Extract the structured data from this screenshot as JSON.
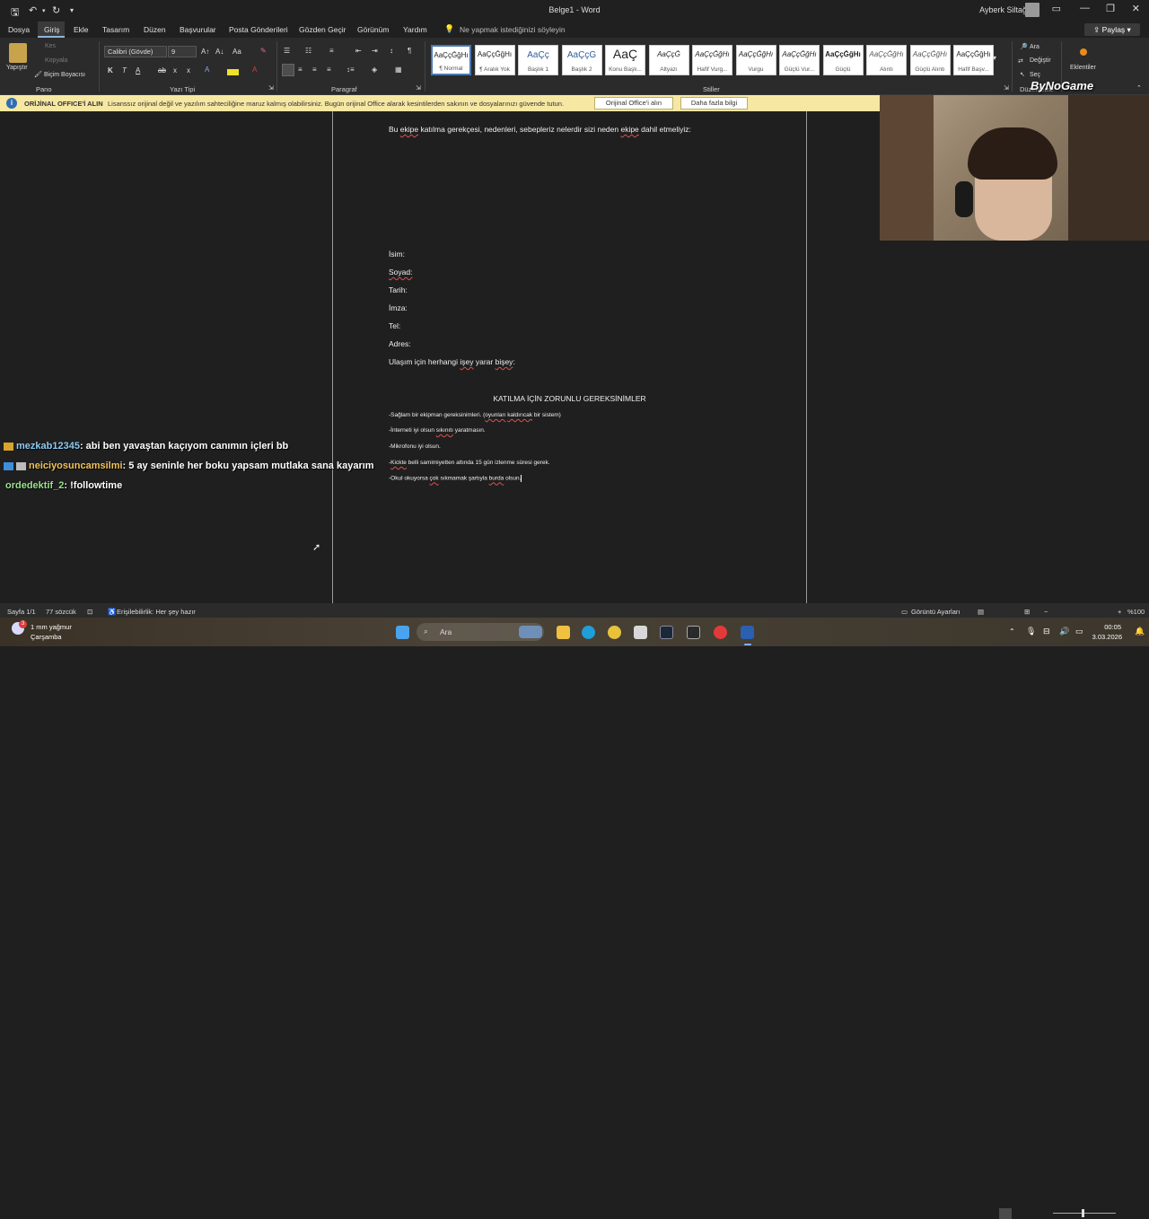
{
  "window": {
    "title": "Belge1  -  Word",
    "user": "Ayberk Siltağ",
    "share_label": "Paylaş"
  },
  "menu": {
    "items": [
      "Dosya",
      "Giriş",
      "Ekle",
      "Tasarım",
      "Düzen",
      "Başvurular",
      "Posta Gönderileri",
      "Gözden Geçir",
      "Görünüm",
      "Yardım"
    ],
    "active": "Giriş",
    "tell_me": "Ne yapmak istediğinizi söyleyin"
  },
  "ribbon": {
    "clipboard": {
      "paste": "Yapıştır",
      "cut": "Kes",
      "copy": "Kopyala",
      "format_painter": "Biçim Boyacısı",
      "label": "Pano"
    },
    "font": {
      "name": "Calibri (Gövde)",
      "size": "9",
      "label": "Yazı Tipi",
      "bold": "K",
      "italic": "T",
      "underline": "A",
      "strike": "ab",
      "sub": "x",
      "sup": "x",
      "case": "Aa"
    },
    "paragraph": {
      "label": "Paragraf"
    },
    "styles": {
      "label": "Stiller",
      "items": [
        {
          "sample": "AaÇçĞğHı",
          "name": "¶ Normal"
        },
        {
          "sample": "AaÇçĞğHı",
          "name": "¶ Aralık Yok"
        },
        {
          "sample": "AaÇç",
          "name": "Başlık 1"
        },
        {
          "sample": "AaÇçĞ",
          "name": "Başlık 2"
        },
        {
          "sample": "AaÇ",
          "name": "Konu Başlı..."
        },
        {
          "sample": "AaÇçĞ",
          "name": "Altyazı"
        },
        {
          "sample": "AaÇçĞğHı",
          "name": "Hafif Vurg..."
        },
        {
          "sample": "AaÇçĞğHı",
          "name": "Vurgu"
        },
        {
          "sample": "AaÇçĞğHı",
          "name": "Güçlü Vur..."
        },
        {
          "sample": "AaÇçĞğHı",
          "name": "Güçlü"
        },
        {
          "sample": "AaÇçĞğHı",
          "name": "Alıntı"
        },
        {
          "sample": "AaÇçĞğHı",
          "name": "Güçlü Alıntı"
        },
        {
          "sample": "AaÇçĞğHı",
          "name": "Hafif Başv..."
        }
      ]
    },
    "editing": {
      "find": "Ara",
      "replace": "Değiştir",
      "select": "Seç",
      "label": "Düzenleme"
    },
    "addins": {
      "label": "Eklentiler"
    }
  },
  "warning": {
    "title": "ORİJİNAL OFFICE'İ ALIN",
    "text": "Lisanssız orijinal değil ve yazılım sahteciliğine maruz kalmış olabilirsiniz. Bugün orijinal Office alarak kesintilerden sakının ve dosyalarınızı güvende tutun.",
    "buy_button": "Orijinal Office'i alın",
    "more_button": "Daha fazla bilgi"
  },
  "document": {
    "question": {
      "pre": "Bu ",
      "w1": "ekipe",
      "mid": " katılma gerekçesi, nedenleri, sebepleriz nelerdir sizi neden ",
      "w2": "ekipe",
      "post": " dahil etmeliyiz:"
    },
    "fields": {
      "isim": "İsim:",
      "soyad": "Soyad:",
      "tarih": "Tarih:",
      "imza": "İmza:",
      "tel": "Tel:",
      "adres": "Adres:",
      "contact_pre": "Ulaşım için herhangi ",
      "contact_w1": "işey",
      "contact_mid": " yarar ",
      "contact_w2": "bişey",
      "contact_post": ":"
    },
    "req_heading": "KATILMA İÇİN ZORUNLU GEREKSİNİMLER",
    "req1": {
      "pre": "-Sağlam bir ekipman gereksinimleri. (",
      "w1": "oyunları",
      "mid": " ",
      "w2": "kaldırıcak",
      "post": " bir sistem)"
    },
    "req2": {
      "pre": "-İnterneti iyi olsun ",
      "w1": "sıkınıtı",
      "post": " yaratmasın."
    },
    "req3": {
      "text": "-Mikrofonu iyi olsun."
    },
    "req4": {
      "pre": "-",
      "w1": "Kickte",
      "post": " belli samimiyetten altında 15 gün izlenme süresi gerek."
    },
    "req5": {
      "pre": "-Okul okuyorsa ",
      "w1": "çok",
      "mid": " sıkmamak şartıyla ",
      "w2": "burda",
      "post": " olsun."
    }
  },
  "chat": [
    {
      "user": "mezkab12345",
      "message": ": abi ben yavaştan kaçıyom canımın içleri bb",
      "color": "#f0c35a"
    },
    {
      "user": "neiciyosuncamsilmi",
      "message": ": 5 ay seninle her boku yapsam mutlaka sana kayarım",
      "color": "#f0c35a"
    },
    {
      "user": "ordedektif_2",
      "message": ": !followtime",
      "color": "#9be28d"
    }
  ],
  "overlay": {
    "brand": "ByNoGame"
  },
  "status": {
    "page": "Sayfa 1/1",
    "words": "77 sözcük",
    "accessibility": "Erişilebilirlik: Her şey hazır",
    "display_settings": "Görüntü Ayarları",
    "zoom": "%100"
  },
  "taskbar": {
    "weather_temp": "1 mm yağmur",
    "weather_day": "Çarşamba",
    "search_placeholder": "Ara",
    "time": "00:05",
    "date": "3.03.2026",
    "notification_count": "3"
  }
}
